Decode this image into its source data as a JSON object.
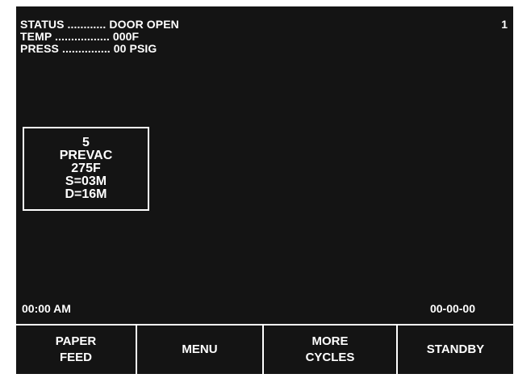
{
  "status": {
    "status_line": "STATUS ............ DOOR OPEN",
    "temp_line": "TEMP ................. 000F",
    "press_line": "PRESS ............... 00 PSIG",
    "page_number": "1"
  },
  "cycle": {
    "number": "5",
    "name": "PREVAC",
    "temperature": "275F",
    "sterilize_time": "S=03M",
    "dry_time": "D=16M"
  },
  "footer": {
    "time": "00:00 AM",
    "date": "00-00-00"
  },
  "softkeys": [
    {
      "label": "PAPER\nFEED"
    },
    {
      "label": "MENU"
    },
    {
      "label": "MORE\nCYCLES"
    },
    {
      "label": "STANDBY"
    }
  ],
  "colors": {
    "screen_background": "#141414",
    "text": "#ffffff"
  }
}
